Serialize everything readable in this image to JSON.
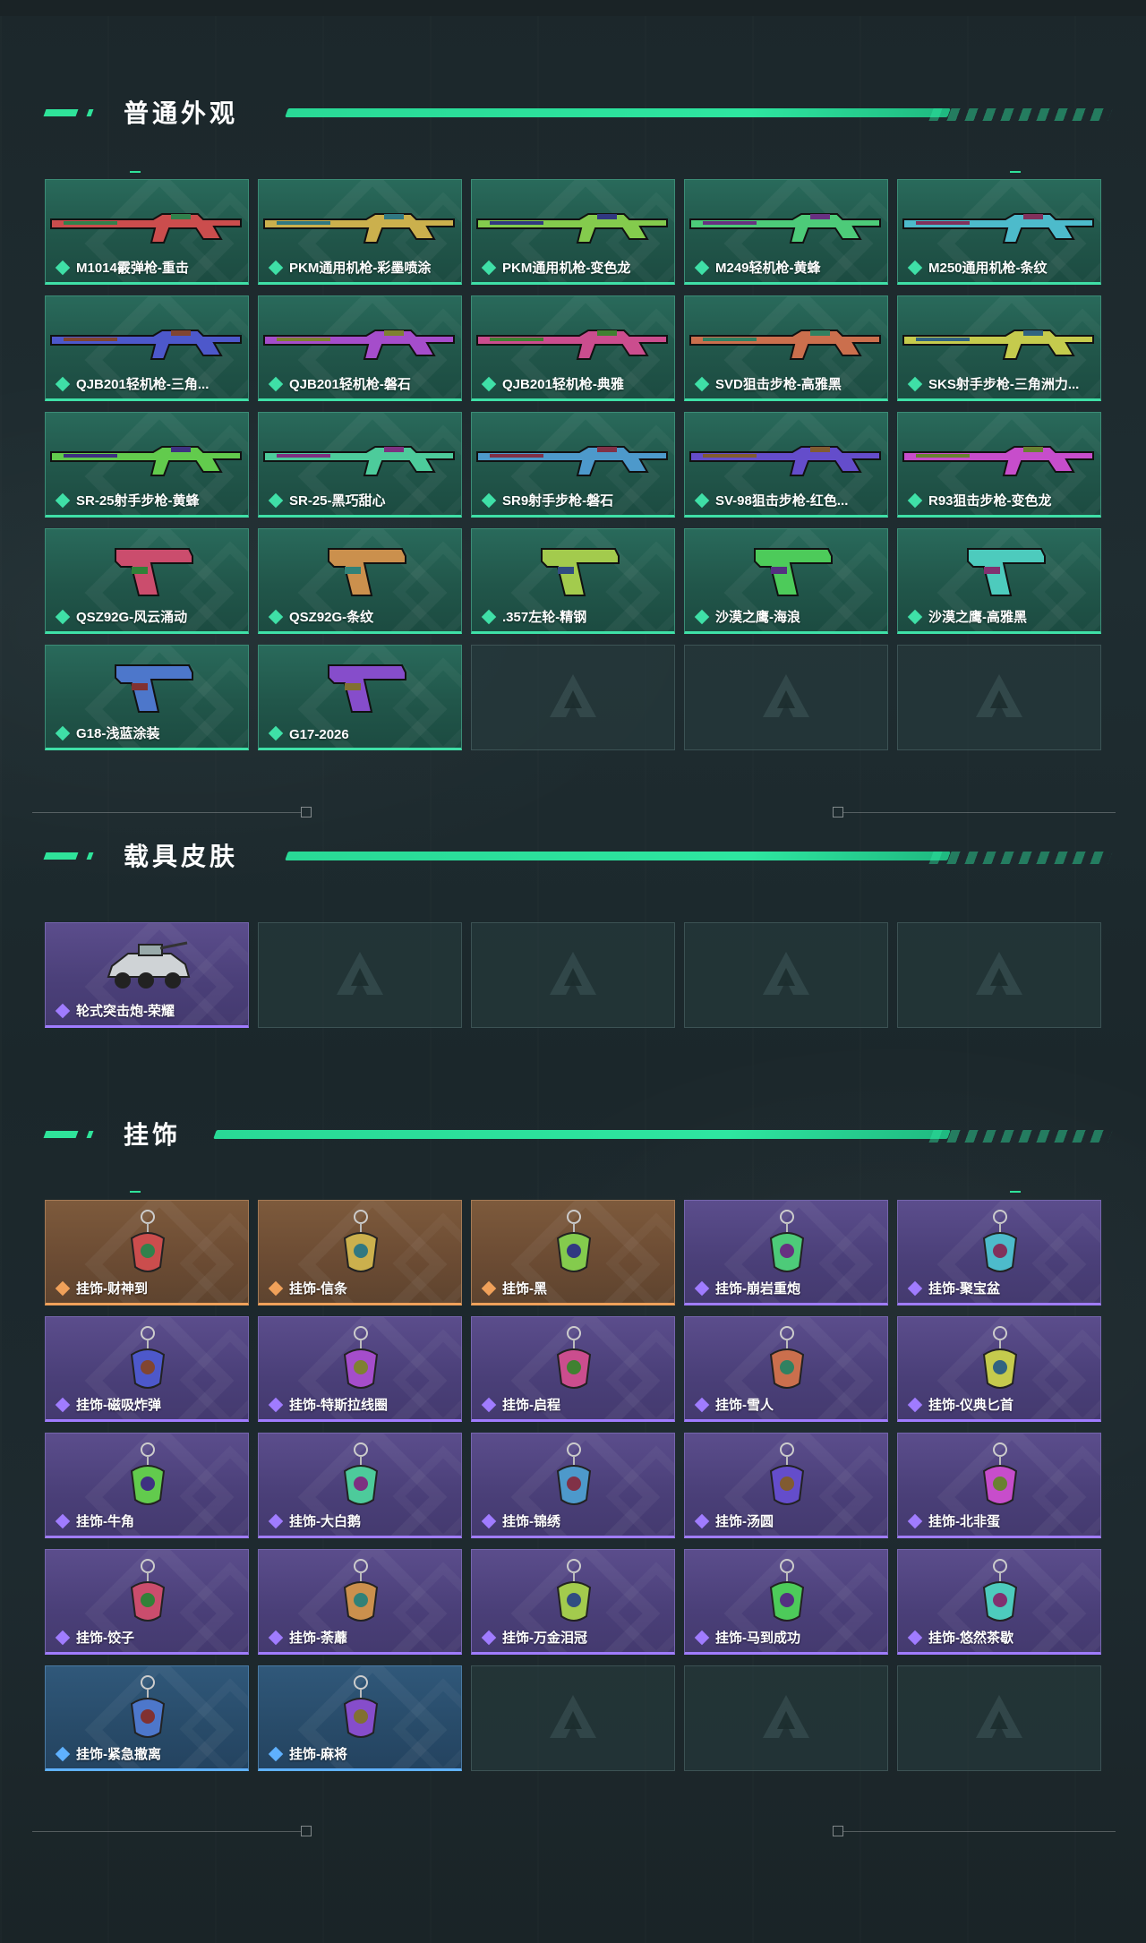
{
  "sections": {
    "weapons": {
      "title": "普通外观"
    },
    "vehicles": {
      "title": "载具皮肤"
    },
    "charms": {
      "title": "挂饰"
    }
  },
  "weapons": [
    {
      "label": "M1014霰弹枪-重击",
      "rarity": "green",
      "icon": "shotgun-icon"
    },
    {
      "label": "PKM通用机枪-彩墨喷涂",
      "rarity": "green",
      "icon": "machine-gun-icon"
    },
    {
      "label": "PKM通用机枪-变色龙",
      "rarity": "green",
      "icon": "machine-gun-icon"
    },
    {
      "label": "M249轻机枪-黄蜂",
      "rarity": "green",
      "icon": "machine-gun-icon"
    },
    {
      "label": "M250通用机枪-条纹",
      "rarity": "green",
      "icon": "machine-gun-icon"
    },
    {
      "label": "QJB201轻机枪-三角...",
      "rarity": "green",
      "icon": "rifle-icon"
    },
    {
      "label": "QJB201轻机枪-磐石",
      "rarity": "green",
      "icon": "rifle-icon"
    },
    {
      "label": "QJB201轻机枪-典雅",
      "rarity": "green",
      "icon": "rifle-icon"
    },
    {
      "label": "SVD狙击步枪-高雅黑",
      "rarity": "green",
      "icon": "sniper-icon"
    },
    {
      "label": "SKS射手步枪-三角洲力...",
      "rarity": "green",
      "icon": "rifle-icon"
    },
    {
      "label": "SR-25射手步枪-黄蜂",
      "rarity": "green",
      "icon": "rifle-icon"
    },
    {
      "label": "SR-25-黑巧甜心",
      "rarity": "green",
      "icon": "rifle-icon"
    },
    {
      "label": "SR9射手步枪-磐石",
      "rarity": "green",
      "icon": "rifle-icon"
    },
    {
      "label": "SV-98狙击步枪-红色...",
      "rarity": "green",
      "icon": "sniper-icon"
    },
    {
      "label": "R93狙击步枪-变色龙",
      "rarity": "green",
      "icon": "sniper-icon"
    },
    {
      "label": "QSZ92G-风云涌动",
      "rarity": "green",
      "icon": "pistol-icon"
    },
    {
      "label": "QSZ92G-条纹",
      "rarity": "green",
      "icon": "pistol-icon"
    },
    {
      "label": ".357左轮-精钢",
      "rarity": "green",
      "icon": "revolver-icon"
    },
    {
      "label": "沙漠之鹰-海浪",
      "rarity": "green",
      "icon": "pistol-icon"
    },
    {
      "label": "沙漠之鹰-高雅黑",
      "rarity": "green",
      "icon": "pistol-icon"
    },
    {
      "label": "G18-浅蓝涂装",
      "rarity": "green",
      "icon": "pistol-icon"
    },
    {
      "label": "G17-2026",
      "rarity": "green",
      "icon": "pistol-icon"
    },
    {
      "label": "",
      "rarity": "empty",
      "icon": "empty-slot-logo-icon"
    },
    {
      "label": "",
      "rarity": "empty",
      "icon": "empty-slot-logo-icon"
    },
    {
      "label": "",
      "rarity": "empty",
      "icon": "empty-slot-logo-icon"
    }
  ],
  "vehicles": [
    {
      "label": "轮式突击炮-荣耀",
      "rarity": "purple",
      "icon": "armored-vehicle-icon"
    },
    {
      "label": "",
      "rarity": "empty",
      "icon": "empty-slot-logo-icon"
    },
    {
      "label": "",
      "rarity": "empty",
      "icon": "empty-slot-logo-icon"
    },
    {
      "label": "",
      "rarity": "empty",
      "icon": "empty-slot-logo-icon"
    },
    {
      "label": "",
      "rarity": "empty",
      "icon": "empty-slot-logo-icon"
    }
  ],
  "charms": [
    {
      "label": "挂饰-财神到",
      "rarity": "orange",
      "icon": "charm-icon"
    },
    {
      "label": "挂饰-信条",
      "rarity": "orange",
      "icon": "charm-icon"
    },
    {
      "label": "挂饰-黑",
      "rarity": "orange",
      "icon": "charm-icon"
    },
    {
      "label": "挂饰-崩岩重炮",
      "rarity": "purple",
      "icon": "charm-icon"
    },
    {
      "label": "挂饰-聚宝盆",
      "rarity": "purple",
      "icon": "charm-icon"
    },
    {
      "label": "挂饰-磁吸炸弹",
      "rarity": "purple",
      "icon": "charm-icon"
    },
    {
      "label": "挂饰-特斯拉线圈",
      "rarity": "purple",
      "icon": "charm-icon"
    },
    {
      "label": "挂饰-启程",
      "rarity": "purple",
      "icon": "charm-icon"
    },
    {
      "label": "挂饰-雪人",
      "rarity": "purple",
      "icon": "charm-icon"
    },
    {
      "label": "挂饰-仪典匕首",
      "rarity": "purple",
      "icon": "charm-icon"
    },
    {
      "label": "挂饰-牛角",
      "rarity": "purple",
      "icon": "charm-icon"
    },
    {
      "label": "挂饰-大白鹅",
      "rarity": "purple",
      "icon": "charm-icon"
    },
    {
      "label": "挂饰-锦绣",
      "rarity": "purple",
      "icon": "charm-icon"
    },
    {
      "label": "挂饰-汤圆",
      "rarity": "purple",
      "icon": "charm-icon"
    },
    {
      "label": "挂饰-北非蛋",
      "rarity": "purple",
      "icon": "charm-icon"
    },
    {
      "label": "挂饰-饺子",
      "rarity": "purple",
      "icon": "charm-icon"
    },
    {
      "label": "挂饰-荼蘼",
      "rarity": "purple",
      "icon": "charm-icon"
    },
    {
      "label": "挂饰-万金泪冠",
      "rarity": "purple",
      "icon": "charm-icon"
    },
    {
      "label": "挂饰-马到成功",
      "rarity": "purple",
      "icon": "charm-icon"
    },
    {
      "label": "挂饰-悠然茶歇",
      "rarity": "purple",
      "icon": "charm-icon"
    },
    {
      "label": "挂饰-紧急撤离",
      "rarity": "blue",
      "icon": "charm-icon"
    },
    {
      "label": "挂饰-麻将",
      "rarity": "blue",
      "icon": "charm-icon"
    },
    {
      "label": "",
      "rarity": "empty",
      "icon": "empty-slot-logo-icon"
    },
    {
      "label": "",
      "rarity": "empty",
      "icon": "empty-slot-logo-icon"
    },
    {
      "label": "",
      "rarity": "empty",
      "icon": "empty-slot-logo-icon"
    }
  ],
  "colors": {
    "accent": "#2fe39a",
    "green_card": "#21564a",
    "purple_card": "#4a3f78",
    "orange_card": "#6b4b33",
    "blue_card": "#284b69"
  }
}
